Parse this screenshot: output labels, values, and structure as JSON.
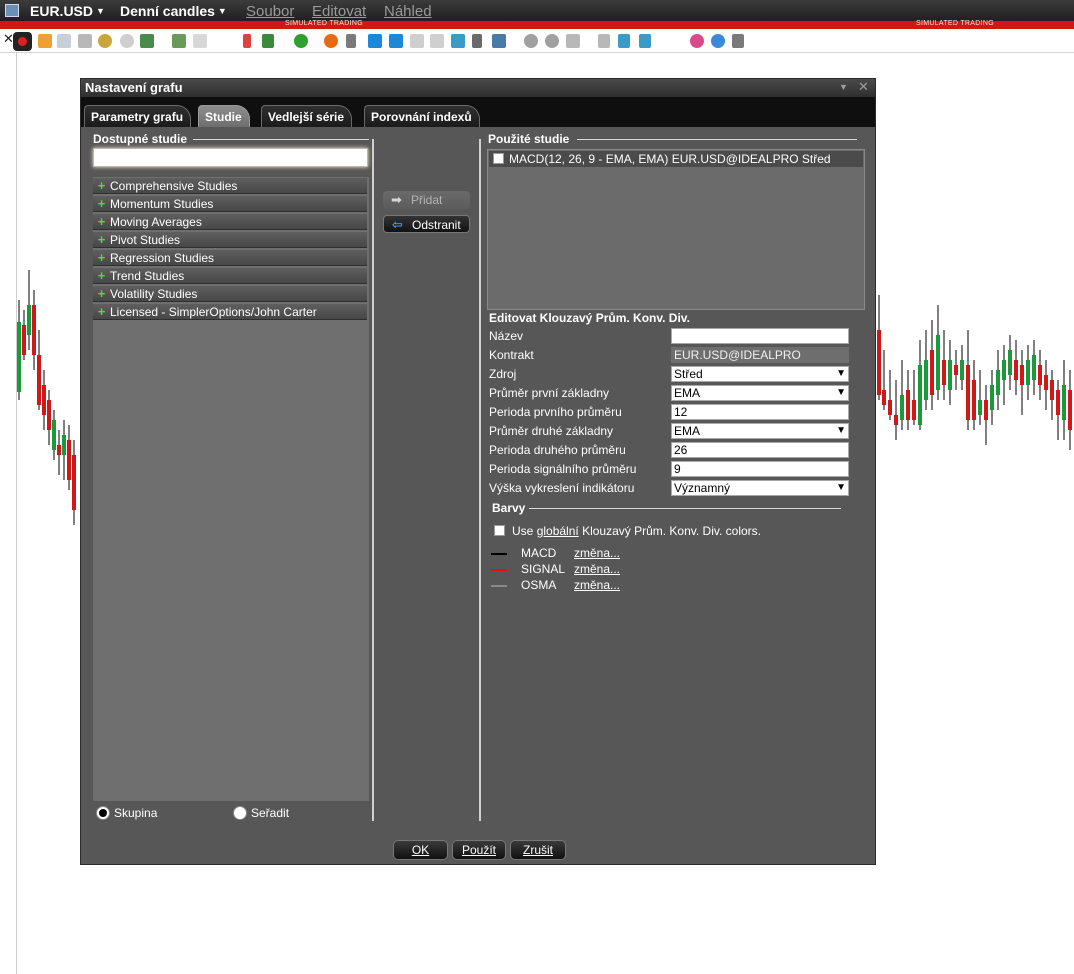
{
  "window": {
    "symbol": "EUR.USD",
    "chart_type": "Denní candles",
    "menus": [
      "Soubor",
      "Editovat",
      "Náhled"
    ],
    "sim_banner": "SIMULATED TRADING"
  },
  "dialog": {
    "title": "Nastavení grafu",
    "tabs": [
      "Parametry grafu",
      "Studie",
      "Vedlejší série",
      "Porovnání indexů"
    ],
    "active_tab": "Studie",
    "available": {
      "label": "Dostupné studie",
      "search_value": "",
      "items": [
        "Comprehensive Studies",
        "Momentum Studies",
        "Moving Averages",
        "Pivot Studies",
        "Regression Studies",
        "Trend Studies",
        "Volatility Studies",
        "Licensed - SimplerOptions/John Carter"
      ],
      "radio_group": "Skupina",
      "radio_sort": "Seřadit"
    },
    "buttons": {
      "add": "Přidat",
      "remove": "Odstranit",
      "ok": "OK",
      "apply": "Použít",
      "cancel": "Zrušit"
    },
    "used": {
      "label": "Použité studie",
      "items": [
        "MACD(12, 26, 9 - EMA, EMA) EUR.USD@IDEALPRO Střed"
      ]
    },
    "edit": {
      "title": "Editovat Klouzavý Prům. Konv. Div.",
      "fields": [
        {
          "label": "Název",
          "value": ""
        },
        {
          "label": "Kontrakt",
          "value": "EUR.USD@IDEALPRO"
        },
        {
          "label": "Zdroj",
          "value": "Střed"
        },
        {
          "label": "Průměr první základny",
          "value": "EMA"
        },
        {
          "label": "Perioda prvního průměru",
          "value": "12"
        },
        {
          "label": "Průměr druhé základny",
          "value": "EMA"
        },
        {
          "label": "Perioda druhého průměru",
          "value": "26"
        },
        {
          "label": "Perioda signálního průměru",
          "value": "9"
        },
        {
          "label": "Výška vykreslení indikátoru",
          "value": "Významný"
        }
      ]
    },
    "colors": {
      "label": "Barvy",
      "use_global_prefix": "Use ",
      "use_global_link": "globální",
      "use_global_suffix": " Klouzavý Prům. Konv. Div. colors.",
      "change_label": "změna...",
      "lines": [
        {
          "name": "MACD",
          "color": "#000000"
        },
        {
          "name": "SIGNAL",
          "color": "#e01010"
        },
        {
          "name": "OSMA",
          "color": "#8a8a8a"
        }
      ]
    }
  }
}
